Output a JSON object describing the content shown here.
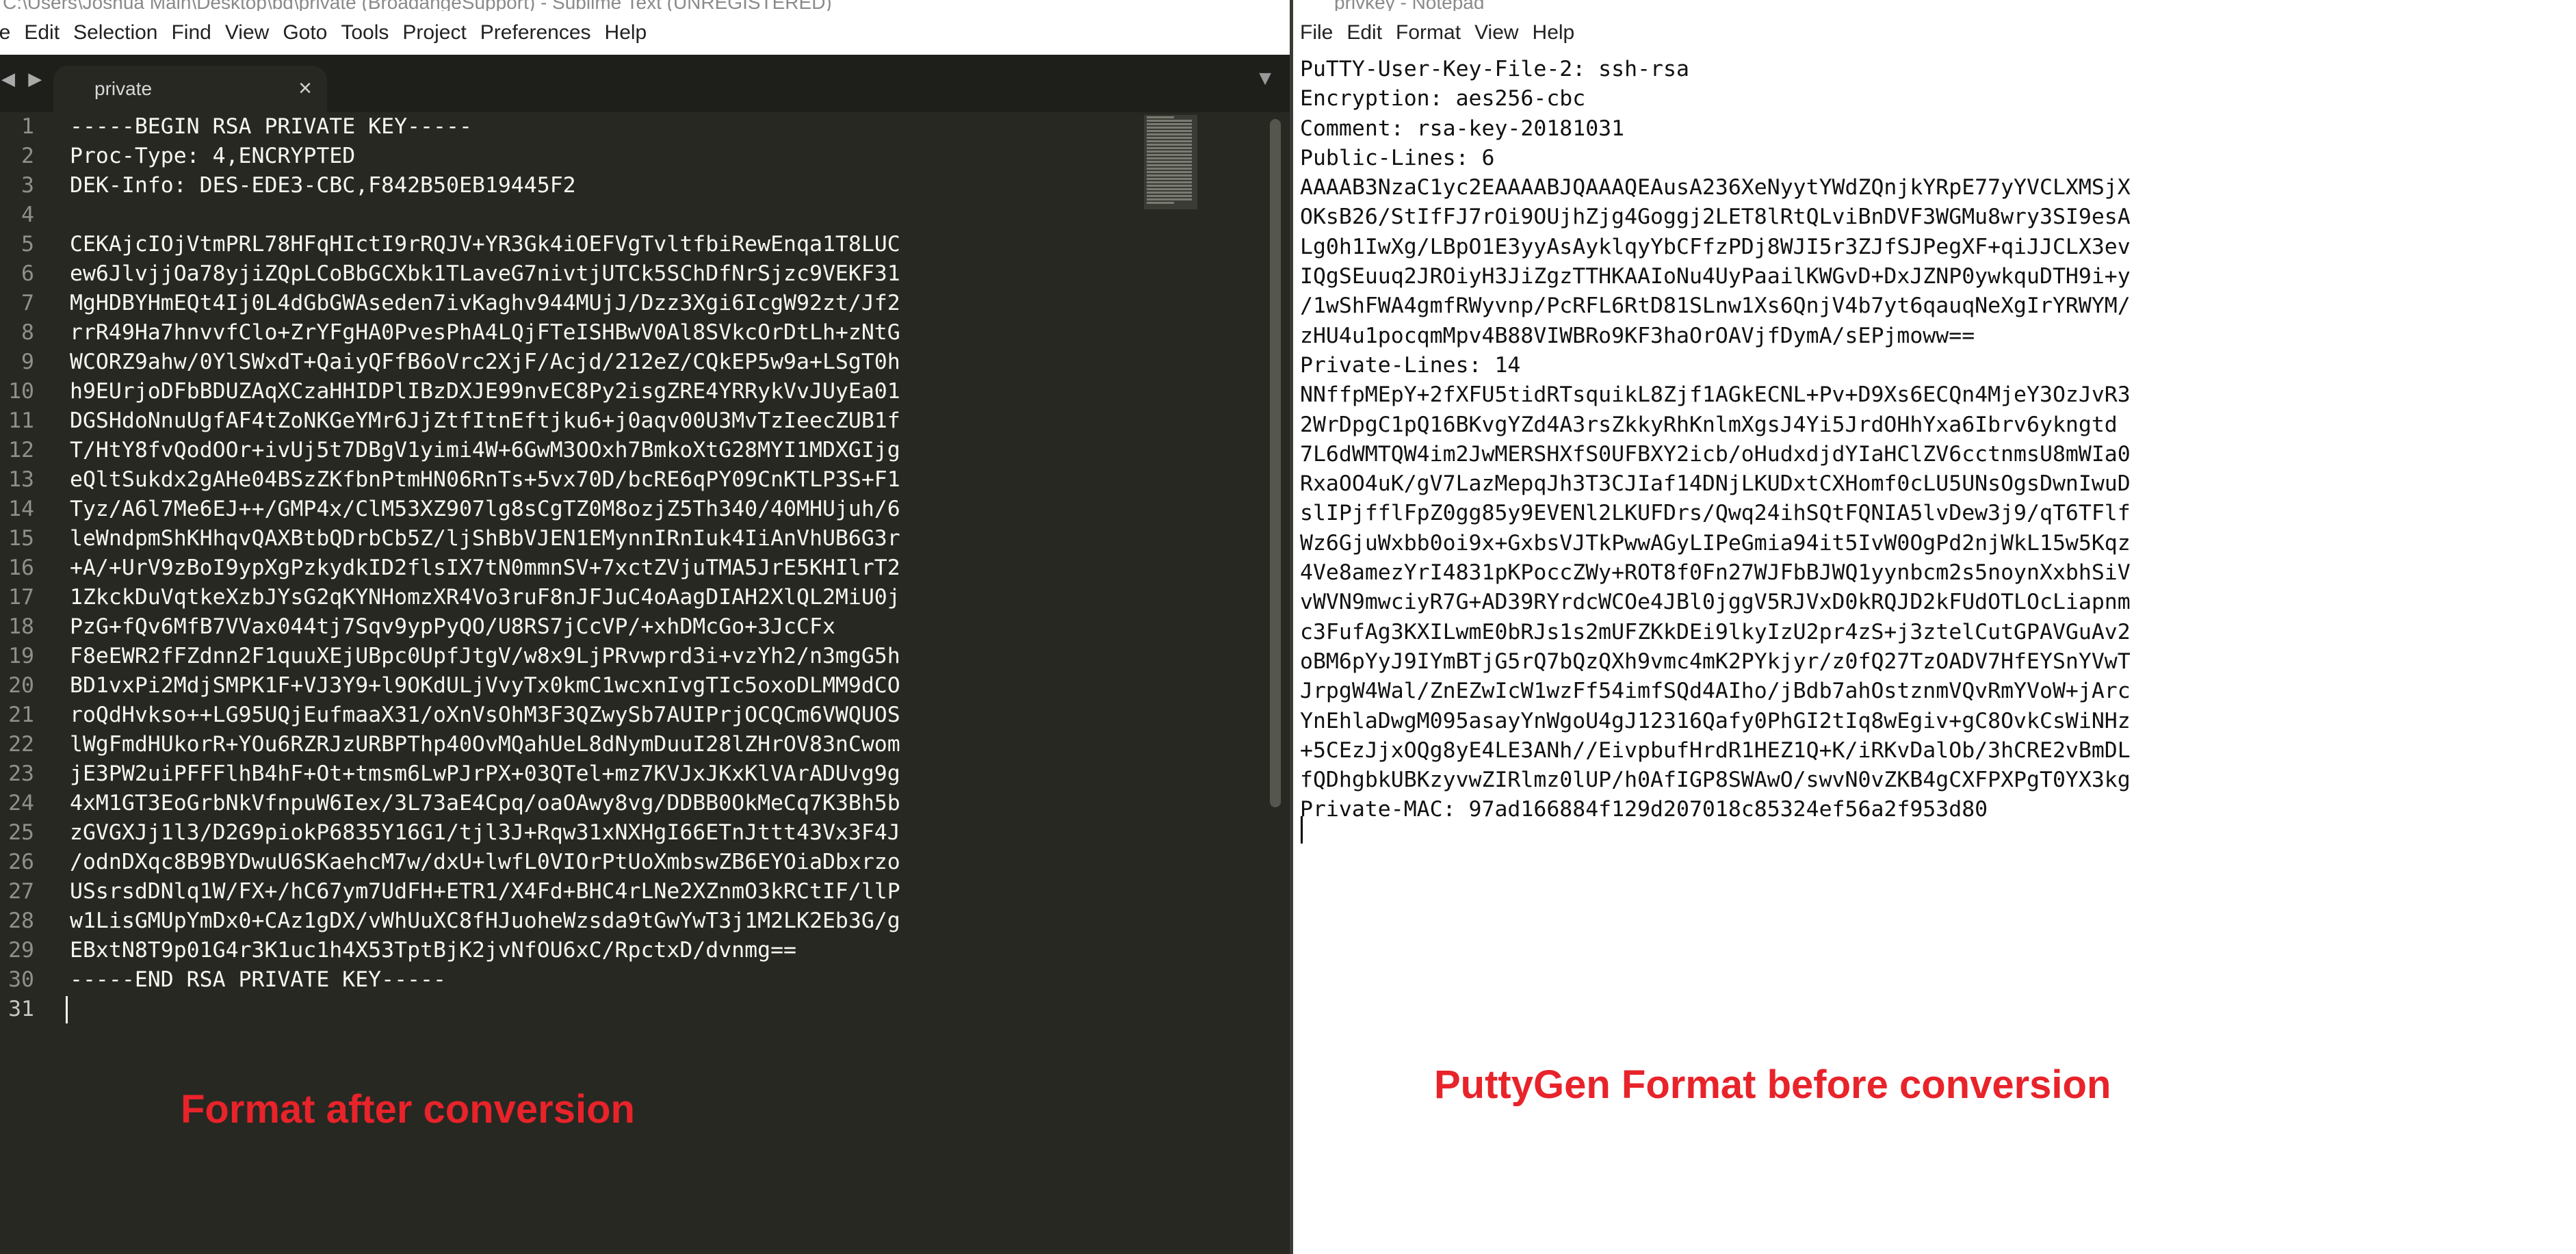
{
  "sublime": {
    "title": "C:\\Users\\Joshua Main\\Desktop\\bd\\private (BroadangeSupport) - Sublime Text (UNREGISTERED)",
    "menu": [
      "le",
      "Edit",
      "Selection",
      "Find",
      "View",
      "Goto",
      "Tools",
      "Project",
      "Preferences",
      "Help"
    ],
    "tab": {
      "label": "private",
      "close": "×"
    },
    "tab_nav": "◀ ▶",
    "tab_menu": "▼",
    "lines": [
      {
        "num": "1",
        "text": "-----BEGIN RSA PRIVATE KEY-----"
      },
      {
        "num": "2",
        "text": "Proc-Type: 4,ENCRYPTED"
      },
      {
        "num": "3",
        "text": "DEK-Info: DES-EDE3-CBC,F842B50EB19445F2"
      },
      {
        "num": "4",
        "text": ""
      },
      {
        "num": "5",
        "text": "CEKAjcIOjVtmPRL78HFqHIctI9rRQJV+YR3Gk4iOEFVgTvltfbiRewEnqa1T8LUC"
      },
      {
        "num": "6",
        "text": "ew6JlvjjOa78yjiZQpLCoBbGCXbk1TLaveG7nivtjUTCk5SChDfNrSjzc9VEKF31"
      },
      {
        "num": "7",
        "text": "MgHDBYHmEQt4Ij0L4dGbGWAseden7ivKaghv944MUjJ/Dzz3Xgi6IcgW92zt/Jf2"
      },
      {
        "num": "8",
        "text": "rrR49Ha7hnvvfClo+ZrYFgHA0PvesPhA4LQjFTeISHBwV0Al8SVkcOrDtLh+zNtG"
      },
      {
        "num": "9",
        "text": "WCORZ9ahw/0YlSWxdT+QaiyQFfB6oVrc2XjF/Acjd/212eZ/CQkEP5w9a+LSgT0h"
      },
      {
        "num": "10",
        "text": "h9EUrjoDFbBDUZAqXCzaHHIDPlIBzDXJE99nvEC8Py2isgZRE4YRRykVvJUyEa01"
      },
      {
        "num": "11",
        "text": "DGSHdoNnuUgfAF4tZoNKGeYMr6JjZtfItnEftjku6+j0aqv00U3MvTzIeecZUB1f"
      },
      {
        "num": "12",
        "text": "T/HtY8fvQodOOr+ivUj5t7DBgV1yimi4W+6GwM3OOxh7BmkoXtG28MYI1MDXGIjg"
      },
      {
        "num": "13",
        "text": "eQltSukdx2gAHe04BSzZKfbnPtmHN06RnTs+5vx70D/bcRE6qPY09CnKTLP3S+F1"
      },
      {
        "num": "14",
        "text": "Tyz/A6l7Me6EJ++/GMP4x/ClM53XZ907lg8sCgTZ0M8ozjZ5Th340/40MHUjuh/6"
      },
      {
        "num": "15",
        "text": "leWndpmShKHhqvQAXBtbQDrbCb5Z/ljShBbVJEN1EMynnIRnIuk4IiAnVhUB6G3r"
      },
      {
        "num": "16",
        "text": "+A/+UrV9zBoI9ypXgPzkydkID2flsIX7tN0mmnSV+7xctZVjuTMA5JrE5KHIlrT2"
      },
      {
        "num": "17",
        "text": "1ZkckDuVqtkeXzbJYsG2qKYNHomzXR4Vo3ruF8nJFJuC4oAagDIAH2XlQL2MiU0j"
      },
      {
        "num": "18",
        "text": "PzG+fQv6MfB7VVax044tj7Sqv9ypPyQO/U8RS7jCcVP/+xhDMcGo+3JcCFx"
      },
      {
        "num": "19",
        "text": "F8eEWR2fFZdnn2F1quuXEjUBpc0UpfJtgV/w8x9LjPRvwprd3i+vzYh2/n3mgG5h"
      },
      {
        "num": "20",
        "text": "BD1vxPi2MdjSMPK1F+VJ3Y9+l9OKdULjVvyTx0kmC1wcxnIvgTIc5oxoDLMM9dCO"
      },
      {
        "num": "21",
        "text": "roQdHvkso++LG95UQjEufmaaX31/oXnVsOhM3F3QZwySb7AUIPrjOCQCm6VWQUOS"
      },
      {
        "num": "22",
        "text": "lWgFmdHUkorR+YOu6RZRJzURBPThp40OvMQahUeL8dNymDuuI28lZHrOV83nCwom"
      },
      {
        "num": "23",
        "text": "jE3PW2uiPFFFlhB4hF+Ot+tmsm6LwPJrPX+03QTel+mz7KVJxJKxKlVArADUvg9g"
      },
      {
        "num": "24",
        "text": "4xM1GT3EoGrbNkVfnpuW6Iex/3L73aE4Cpq/oaOAwy8vg/DDBB0OkMeCq7K3Bh5b"
      },
      {
        "num": "25",
        "text": "zGVGXJj1l3/D2G9piokP6835Y16G1/tjl3J+Rqw31xNXHgI66ETnJttt43Vx3F4J"
      },
      {
        "num": "26",
        "text": "/odnDXqc8B9BYDwuU6SKaehcM7w/dxU+lwfL0VIOrPtUoXmbswZB6EYOiaDbxrzo"
      },
      {
        "num": "27",
        "text": "USsrsdDNlq1W/FX+/hC67ym7UdFH+ETR1/X4Fd+BHC4rLNe2XZnmO3kRCtIF/llP"
      },
      {
        "num": "28",
        "text": "w1LisGMUpYmDx0+CAz1gDX/vWhUuXC8fHJuoheWzsda9tGwYwT3j1M2LK2Eb3G/g"
      },
      {
        "num": "29",
        "text": "EBxtN8T9p01G4r3K1uc1h4X53TptBjK2jvNfOU6xC/RpctxD/dvnmg=="
      },
      {
        "num": "30",
        "text": "-----END RSA PRIVATE KEY-----"
      },
      {
        "num": "31",
        "text": ""
      }
    ]
  },
  "notepad": {
    "title": "privkey - Notepad",
    "menu": [
      "File",
      "Edit",
      "Format",
      "View",
      "Help"
    ],
    "content": "PuTTY-User-Key-File-2: ssh-rsa\nEncryption: aes256-cbc\nComment: rsa-key-20181031\nPublic-Lines: 6\nAAAAB3NzaC1yc2EAAAABJQAAAQEAusA236XeNyytYWdZQnjkYRpE77yYVCLXMSjX\nOKsB26/StIfFJ7rOi9OUjhZjg4Goggj2LET8lRtQLviBnDVF3WGMu8wry3SI9esA\nLg0h1IwXg/LBpO1E3yyAsAyklqyYbCFfzPDj8WJI5r3ZJfSJPegXF+qiJJCLX3ev\nIQgSEuuq2JROiyH3JiZgzTTHKAAIoNu4UyPaailKWGvD+DxJZNP0ywkquDTH9i+y\n/1wShFWA4gmfRWyvnp/PcRFL6RtD81SLnw1Xs6QnjV4b7yt6qauqNeXgIrYRWYM/\nzHU4u1pocqmMpv4B88VIWBRo9KF3haOrOAVjfDymA/sEPjmoww==\nPrivate-Lines: 14\nNNffpMEpY+2fXFU5tidRTsquikL8Zjf1AGkECNL+Pv+D9Xs6ECQn4MjeY3OzJvR3\n2WrDpgC1pQ16BKvgYZd4A3rsZkkyRhKnlmXgsJ4Yi5JrdOHhYxa6Ibrv6ykngtd\n7L6dWMTQW4im2JwMERSHXfS0UFBXY2icb/oHudxdjdYIaHClZV6cctnmsU8mWIa0\nRxaOO4uK/gV7LazMepqJh3T3CJIaf14DNjLKUDxtCXHomf0cLU5UNsOgsDwnIwuD\nslIPjfflFpZ0gg85y9EVENl2LKUFDrs/Qwq24ihSQtFQNIA5lvDew3j9/qT6TFlf\nWz6GjuWxbb0oi9x+GxbsVJTkPwwAGyLIPeGmia94it5IvW0OgPd2njWkL15w5Kqz\n4Ve8amezYrI4831pKPoccZWy+ROT8f0Fn27WJFbBJWQ1yynbcm2s5noynXxbhSiV\nvWVN9mwciyR7G+AD39RYrdcWCOe4JBl0jggV5RJVxD0kRQJD2kFUdOTLOcLiapnm\nc3FufAg3KXILwmE0bRJs1s2mUFZKkDEi9lkyIzU2pr4zS+j3ztelCutGPAVGuAv2\noBM6pYyJ9IYmBTjG5rQ7bQzQXh9vmc4mK2PYkjyr/z0fQ27TzOADV7HfEYSnYVwT\nJrpgW4Wal/ZnEZwIcW1wzFf54imfSQd4AIho/jBdb7ahOstznmVQvRmYVoW+jArc\nYnEhlaDwgM095asayYnWgoU4gJ12316Qafy0PhGI2tIq8wEgiv+gC8OvkCsWiNHz\n+5CEzJjxOQg8yE4LE3ANh//EivpbufHrdR1HEZ1Q+K/iRKvDalOb/3hCRE2vBmDL\nfQDhgbkUBKzyvwZIRlmz0lUP/h0AfIGP8SWAwO/swvN0vZKB4gCXFPXPgT0YX3kg\nPrivate-MAC: 97ad166884f129d207018c85324ef56a2f953d80",
    "window_controls": "—  ❐  ✕"
  },
  "annotations": {
    "left": "Format after conversion",
    "right": "PuttyGen Format before conversion"
  },
  "colors": {
    "sublime_bg": "#272822",
    "sublime_fg": "#f8f8f2",
    "line_number": "#90908a",
    "annotation": "#e8232a"
  }
}
